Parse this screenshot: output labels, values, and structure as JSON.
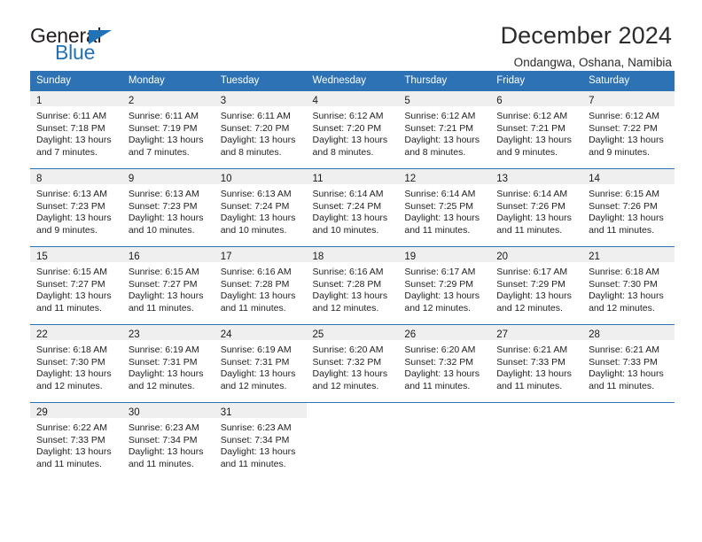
{
  "brand": {
    "name_part1": "General",
    "name_part2": "Blue",
    "accent_color": "#2272b8"
  },
  "header": {
    "title": "December 2024",
    "subtitle": "Ondangwa, Oshana, Namibia"
  },
  "calendar": {
    "header_bg": "#2c72b5",
    "daynum_band_bg": "#efefef",
    "weekday_headers": [
      "Sunday",
      "Monday",
      "Tuesday",
      "Wednesday",
      "Thursday",
      "Friday",
      "Saturday"
    ],
    "weeks": [
      [
        {
          "day": "1",
          "sunrise": "Sunrise: 6:11 AM",
          "sunset": "Sunset: 7:18 PM",
          "daylight_line1": "Daylight: 13 hours",
          "daylight_line2": "and 7 minutes."
        },
        {
          "day": "2",
          "sunrise": "Sunrise: 6:11 AM",
          "sunset": "Sunset: 7:19 PM",
          "daylight_line1": "Daylight: 13 hours",
          "daylight_line2": "and 7 minutes."
        },
        {
          "day": "3",
          "sunrise": "Sunrise: 6:11 AM",
          "sunset": "Sunset: 7:20 PM",
          "daylight_line1": "Daylight: 13 hours",
          "daylight_line2": "and 8 minutes."
        },
        {
          "day": "4",
          "sunrise": "Sunrise: 6:12 AM",
          "sunset": "Sunset: 7:20 PM",
          "daylight_line1": "Daylight: 13 hours",
          "daylight_line2": "and 8 minutes."
        },
        {
          "day": "5",
          "sunrise": "Sunrise: 6:12 AM",
          "sunset": "Sunset: 7:21 PM",
          "daylight_line1": "Daylight: 13 hours",
          "daylight_line2": "and 8 minutes."
        },
        {
          "day": "6",
          "sunrise": "Sunrise: 6:12 AM",
          "sunset": "Sunset: 7:21 PM",
          "daylight_line1": "Daylight: 13 hours",
          "daylight_line2": "and 9 minutes."
        },
        {
          "day": "7",
          "sunrise": "Sunrise: 6:12 AM",
          "sunset": "Sunset: 7:22 PM",
          "daylight_line1": "Daylight: 13 hours",
          "daylight_line2": "and 9 minutes."
        }
      ],
      [
        {
          "day": "8",
          "sunrise": "Sunrise: 6:13 AM",
          "sunset": "Sunset: 7:23 PM",
          "daylight_line1": "Daylight: 13 hours",
          "daylight_line2": "and 9 minutes."
        },
        {
          "day": "9",
          "sunrise": "Sunrise: 6:13 AM",
          "sunset": "Sunset: 7:23 PM",
          "daylight_line1": "Daylight: 13 hours",
          "daylight_line2": "and 10 minutes."
        },
        {
          "day": "10",
          "sunrise": "Sunrise: 6:13 AM",
          "sunset": "Sunset: 7:24 PM",
          "daylight_line1": "Daylight: 13 hours",
          "daylight_line2": "and 10 minutes."
        },
        {
          "day": "11",
          "sunrise": "Sunrise: 6:14 AM",
          "sunset": "Sunset: 7:24 PM",
          "daylight_line1": "Daylight: 13 hours",
          "daylight_line2": "and 10 minutes."
        },
        {
          "day": "12",
          "sunrise": "Sunrise: 6:14 AM",
          "sunset": "Sunset: 7:25 PM",
          "daylight_line1": "Daylight: 13 hours",
          "daylight_line2": "and 11 minutes."
        },
        {
          "day": "13",
          "sunrise": "Sunrise: 6:14 AM",
          "sunset": "Sunset: 7:26 PM",
          "daylight_line1": "Daylight: 13 hours",
          "daylight_line2": "and 11 minutes."
        },
        {
          "day": "14",
          "sunrise": "Sunrise: 6:15 AM",
          "sunset": "Sunset: 7:26 PM",
          "daylight_line1": "Daylight: 13 hours",
          "daylight_line2": "and 11 minutes."
        }
      ],
      [
        {
          "day": "15",
          "sunrise": "Sunrise: 6:15 AM",
          "sunset": "Sunset: 7:27 PM",
          "daylight_line1": "Daylight: 13 hours",
          "daylight_line2": "and 11 minutes."
        },
        {
          "day": "16",
          "sunrise": "Sunrise: 6:15 AM",
          "sunset": "Sunset: 7:27 PM",
          "daylight_line1": "Daylight: 13 hours",
          "daylight_line2": "and 11 minutes."
        },
        {
          "day": "17",
          "sunrise": "Sunrise: 6:16 AM",
          "sunset": "Sunset: 7:28 PM",
          "daylight_line1": "Daylight: 13 hours",
          "daylight_line2": "and 11 minutes."
        },
        {
          "day": "18",
          "sunrise": "Sunrise: 6:16 AM",
          "sunset": "Sunset: 7:28 PM",
          "daylight_line1": "Daylight: 13 hours",
          "daylight_line2": "and 12 minutes."
        },
        {
          "day": "19",
          "sunrise": "Sunrise: 6:17 AM",
          "sunset": "Sunset: 7:29 PM",
          "daylight_line1": "Daylight: 13 hours",
          "daylight_line2": "and 12 minutes."
        },
        {
          "day": "20",
          "sunrise": "Sunrise: 6:17 AM",
          "sunset": "Sunset: 7:29 PM",
          "daylight_line1": "Daylight: 13 hours",
          "daylight_line2": "and 12 minutes."
        },
        {
          "day": "21",
          "sunrise": "Sunrise: 6:18 AM",
          "sunset": "Sunset: 7:30 PM",
          "daylight_line1": "Daylight: 13 hours",
          "daylight_line2": "and 12 minutes."
        }
      ],
      [
        {
          "day": "22",
          "sunrise": "Sunrise: 6:18 AM",
          "sunset": "Sunset: 7:30 PM",
          "daylight_line1": "Daylight: 13 hours",
          "daylight_line2": "and 12 minutes."
        },
        {
          "day": "23",
          "sunrise": "Sunrise: 6:19 AM",
          "sunset": "Sunset: 7:31 PM",
          "daylight_line1": "Daylight: 13 hours",
          "daylight_line2": "and 12 minutes."
        },
        {
          "day": "24",
          "sunrise": "Sunrise: 6:19 AM",
          "sunset": "Sunset: 7:31 PM",
          "daylight_line1": "Daylight: 13 hours",
          "daylight_line2": "and 12 minutes."
        },
        {
          "day": "25",
          "sunrise": "Sunrise: 6:20 AM",
          "sunset": "Sunset: 7:32 PM",
          "daylight_line1": "Daylight: 13 hours",
          "daylight_line2": "and 12 minutes."
        },
        {
          "day": "26",
          "sunrise": "Sunrise: 6:20 AM",
          "sunset": "Sunset: 7:32 PM",
          "daylight_line1": "Daylight: 13 hours",
          "daylight_line2": "and 11 minutes."
        },
        {
          "day": "27",
          "sunrise": "Sunrise: 6:21 AM",
          "sunset": "Sunset: 7:33 PM",
          "daylight_line1": "Daylight: 13 hours",
          "daylight_line2": "and 11 minutes."
        },
        {
          "day": "28",
          "sunrise": "Sunrise: 6:21 AM",
          "sunset": "Sunset: 7:33 PM",
          "daylight_line1": "Daylight: 13 hours",
          "daylight_line2": "and 11 minutes."
        }
      ],
      [
        {
          "day": "29",
          "sunrise": "Sunrise: 6:22 AM",
          "sunset": "Sunset: 7:33 PM",
          "daylight_line1": "Daylight: 13 hours",
          "daylight_line2": "and 11 minutes."
        },
        {
          "day": "30",
          "sunrise": "Sunrise: 6:23 AM",
          "sunset": "Sunset: 7:34 PM",
          "daylight_line1": "Daylight: 13 hours",
          "daylight_line2": "and 11 minutes."
        },
        {
          "day": "31",
          "sunrise": "Sunrise: 6:23 AM",
          "sunset": "Sunset: 7:34 PM",
          "daylight_line1": "Daylight: 13 hours",
          "daylight_line2": "and 11 minutes."
        },
        {
          "day": "",
          "sunrise": "",
          "sunset": "",
          "daylight_line1": "",
          "daylight_line2": ""
        },
        {
          "day": "",
          "sunrise": "",
          "sunset": "",
          "daylight_line1": "",
          "daylight_line2": ""
        },
        {
          "day": "",
          "sunrise": "",
          "sunset": "",
          "daylight_line1": "",
          "daylight_line2": ""
        },
        {
          "day": "",
          "sunrise": "",
          "sunset": "",
          "daylight_line1": "",
          "daylight_line2": ""
        }
      ]
    ]
  }
}
